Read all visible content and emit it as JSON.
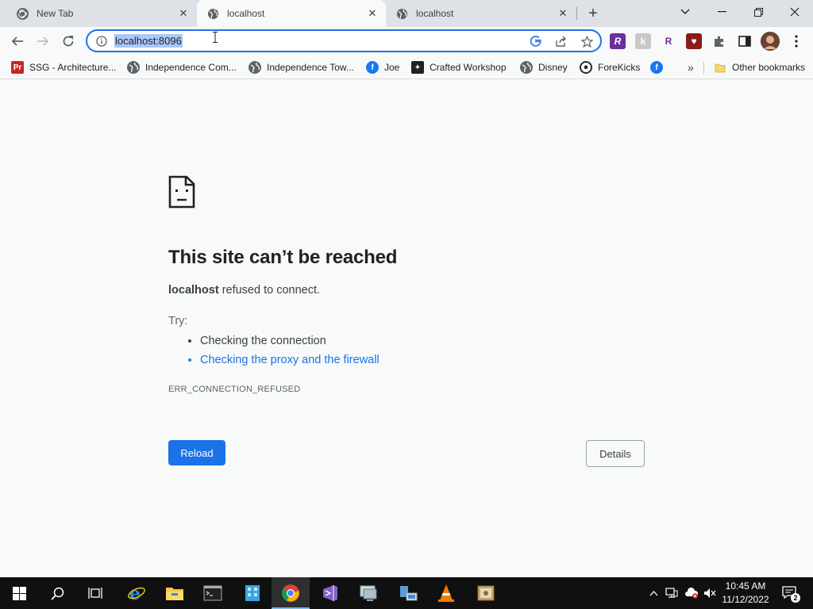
{
  "tabs": [
    {
      "title": "New Tab",
      "icon": "chrome-icon",
      "active": false
    },
    {
      "title": "localhost",
      "icon": "globe-icon",
      "active": true
    },
    {
      "title": "localhost",
      "icon": "globe-icon",
      "active": false
    }
  ],
  "omnibox": {
    "url": "localhost:8096"
  },
  "bookmarks": [
    {
      "label": "SSG - Architecture...",
      "icon": "pr-logo-icon"
    },
    {
      "label": "Independence Com...",
      "icon": "globe-icon"
    },
    {
      "label": "Independence Tow...",
      "icon": "globe-icon"
    },
    {
      "label": "Joe",
      "icon": "facebook-icon"
    },
    {
      "label": "Crafted Workshop",
      "icon": "crafted-logo-icon"
    },
    {
      "label": "Disney",
      "icon": "globe-icon"
    },
    {
      "label": "ForeKicks",
      "icon": "soccer-ball-icon"
    },
    {
      "label": "",
      "icon": "facebook-icon"
    }
  ],
  "bookmarks_other": "Other bookmarks",
  "error": {
    "title": "This site can’t be reached",
    "host": "localhost",
    "message": "refused to connect.",
    "try_label": "Try:",
    "suggestions": [
      "Checking the connection",
      "Checking the proxy and the firewall"
    ],
    "code": "ERR_CONNECTION_REFUSED",
    "reload_label": "Reload",
    "details_label": "Details"
  },
  "taskbar": {
    "time": "10:45 AM",
    "date": "11/12/2022",
    "notification_count": "2"
  },
  "colors": {
    "accent": "#1a73e8",
    "page_bg": "#f8faf9",
    "tabstrip_bg": "#dee1e6",
    "taskbar_bg": "#101010"
  }
}
